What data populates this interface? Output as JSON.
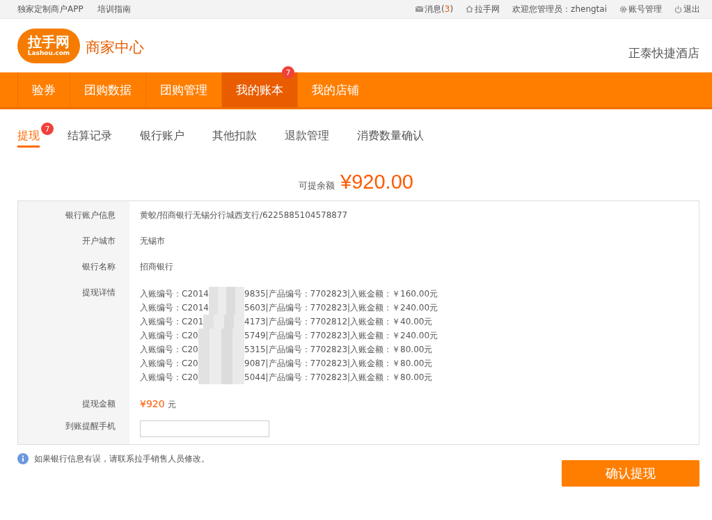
{
  "top_bar": {
    "left_links": [
      "独家定制商户APP",
      "培训指南"
    ],
    "messages": {
      "label": "消息(",
      "count": "3",
      "close": ")"
    },
    "site_link": "拉手网",
    "welcome": "欢迎您管理员：zhengtai",
    "account": "账号管理",
    "logout": "退出"
  },
  "header": {
    "logo_text": "拉手网",
    "logo_sub": "Lashou.com",
    "title": "商家中心",
    "shop_name": "正泰快捷酒店"
  },
  "main_nav": [
    {
      "label": "验券",
      "selected": false
    },
    {
      "label": "团购数据",
      "selected": false
    },
    {
      "label": "团购管理",
      "selected": false
    },
    {
      "label": "我的账本",
      "selected": true,
      "badge": "7"
    },
    {
      "label": "我的店铺",
      "selected": false
    }
  ],
  "sub_tabs": [
    {
      "label": "提现",
      "selected": true,
      "badge": "7"
    },
    {
      "label": "结算记录",
      "selected": false
    },
    {
      "label": "银行账户",
      "selected": false
    },
    {
      "label": "其他扣款",
      "selected": false
    },
    {
      "label": "退款管理",
      "selected": false
    },
    {
      "label": "消费数量确认",
      "selected": false
    }
  ],
  "balance": {
    "label": "可提余额",
    "amount": "¥920.00"
  },
  "form": {
    "bank_info": {
      "label": "银行账户信息",
      "value": "黄蛟/招商银行无锡分行城西支行/6225885104578877"
    },
    "city": {
      "label": "开户城市",
      "value": "无锡市"
    },
    "bank_name": {
      "label": "银行名称",
      "value": "招商银行"
    },
    "details": {
      "label": "提现详情",
      "lines": [
        {
          "prefix": "入账编号：C2014",
          "suffix": "9835|产品编号：7702823|入账金额：￥160.00元"
        },
        {
          "prefix": "入账编号：C2014",
          "suffix": "5603|产品编号：7702823|入账金额：￥240.00元"
        },
        {
          "prefix": "入账编号：C201",
          "suffix": "4173|产品编号：7702812|入账金额：￥40.00元"
        },
        {
          "prefix": "入账编号：C20",
          "suffix": "5749|产品编号：7702823|入账金额：￥240.00元"
        },
        {
          "prefix": "入账编号：C20",
          "suffix": "5315|产品编号：7702823|入账金额：￥80.00元"
        },
        {
          "prefix": "入账编号：C20",
          "suffix": "9087|产品编号：7702823|入账金额：￥80.00元"
        },
        {
          "prefix": "入账编号：C20",
          "suffix": "5044|产品编号：7702823|入账金额：￥80.00元"
        }
      ]
    },
    "amount": {
      "label": "提现金额",
      "value": "¥920",
      "unit": "元"
    },
    "phone": {
      "label": "到账提醒手机"
    }
  },
  "notice": "如果银行信息有误，请联系拉手销售人员修改。",
  "confirm_button": "确认提现"
}
